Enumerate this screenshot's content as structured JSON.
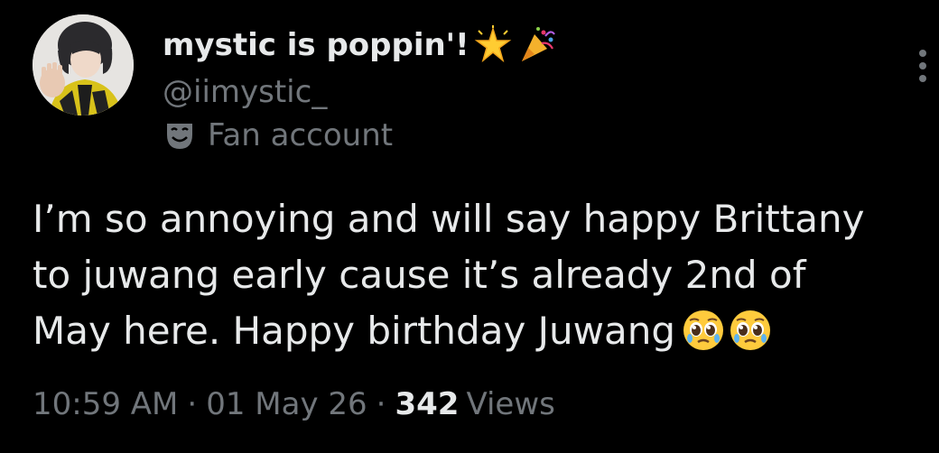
{
  "author": {
    "display_name": "mystic is poppin'!",
    "handle": "@iimystic_",
    "label": "Fan account",
    "name_emojis": [
      "glowing-star",
      "party-popper"
    ]
  },
  "tweet": {
    "text_lines": [
      "I’m so annoying and will say happy Brittany",
      "to juwang early cause it’s already 2nd of",
      "May here. Happy birthday Juwang"
    ],
    "trailing_emojis": [
      "pleading-face",
      "pleading-face"
    ]
  },
  "meta": {
    "time": "10:59 AM",
    "separator": "·",
    "date": "01 May 26",
    "views_count": "342",
    "views_label": "Views"
  },
  "colors": {
    "background": "#000000",
    "primary_text": "#e7e9ea",
    "secondary_text": "#71767b"
  }
}
